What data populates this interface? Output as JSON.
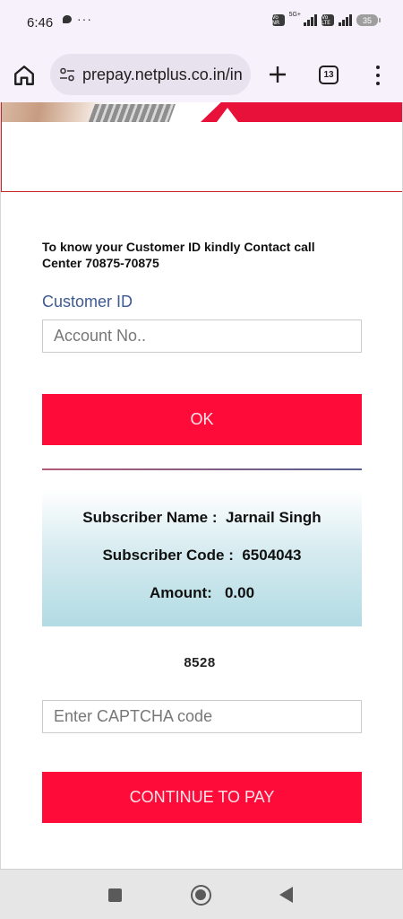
{
  "status_bar": {
    "time": "6:46",
    "more": "···",
    "network1": "5G+",
    "volte1": "Vo NR",
    "volte2": "Vo LTE",
    "battery": "35"
  },
  "browser": {
    "url": "prepay.netplus.co.in/in",
    "tab_count": "13"
  },
  "page": {
    "info_text": "To know your Customer ID kindly Contact call Center 70875-70875",
    "customer_id_label": "Customer ID",
    "account_placeholder": "Account No..",
    "ok_label": "OK",
    "subscriber_name_line": "Subscriber Name :  Jarnail Singh",
    "subscriber_code_line": "Subscriber Code :  6504043",
    "amount_line": "Amount:   0.00",
    "captcha_code": "8528",
    "captcha_placeholder": "Enter CAPTCHA code",
    "continue_label": "CONTINUE TO PAY"
  },
  "colors": {
    "accent_red": "#ff0b3a",
    "label_blue": "#3d5a91",
    "browser_bg": "#f7f1fb"
  },
  "icons": [
    "chat-icon",
    "home-icon",
    "site-settings-icon",
    "new-tab-icon",
    "tab-switcher-icon",
    "overflow-menu-icon",
    "recents-nav-icon",
    "home-nav-icon",
    "back-nav-icon"
  ]
}
